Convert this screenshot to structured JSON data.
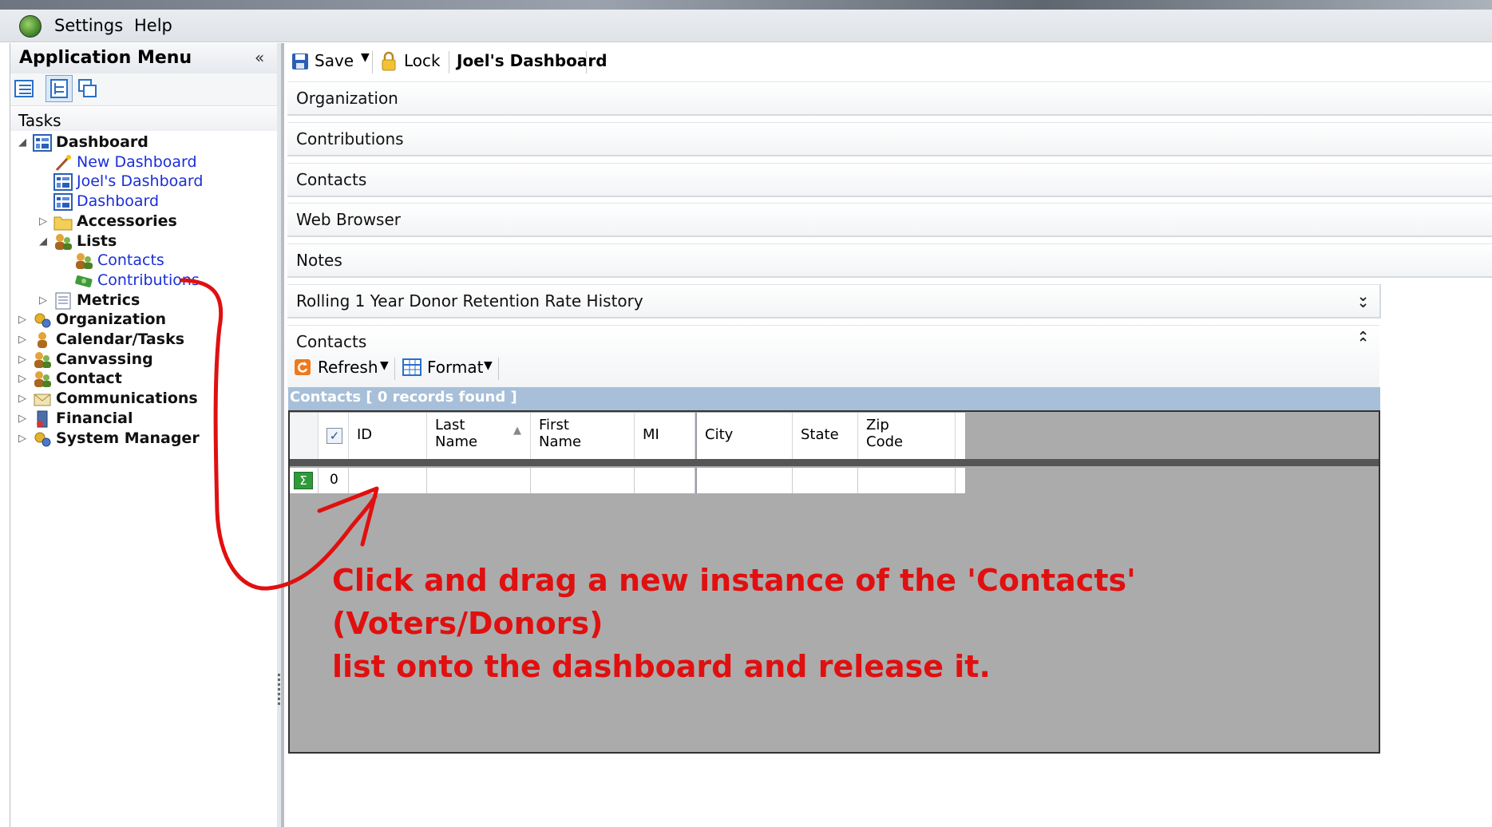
{
  "menubar": {
    "items": [
      "Settings",
      "Help"
    ]
  },
  "left_panel": {
    "title": "Application Menu",
    "collapse_glyph": "«",
    "tasks_label": "Tasks",
    "tree": [
      {
        "label": "Dashboard",
        "style": "bold",
        "icon": "dashboard-icon",
        "expander": "open"
      },
      {
        "label": "New Dashboard",
        "style": "link",
        "icon": "wand-icon",
        "expander": "none"
      },
      {
        "label": "Joel's Dashboard",
        "style": "link",
        "icon": "dashboard-icon",
        "expander": "none"
      },
      {
        "label": "Dashboard",
        "style": "link",
        "icon": "dashboard-icon",
        "expander": "none"
      },
      {
        "label": "Accessories",
        "style": "bold",
        "icon": "folder-icon",
        "expander": "closed"
      },
      {
        "label": "Lists",
        "style": "bold",
        "icon": "people-icon",
        "expander": "open"
      },
      {
        "label": "Contacts",
        "style": "link",
        "icon": "people-icon",
        "expander": "none"
      },
      {
        "label": "Contributions",
        "style": "link",
        "icon": "money-icon",
        "expander": "none"
      },
      {
        "label": "Metrics",
        "style": "bold",
        "icon": "report-icon",
        "expander": "closed"
      },
      {
        "label": "Organization",
        "style": "bold",
        "icon": "gears-icon",
        "expander": "closed"
      },
      {
        "label": "Calendar/Tasks",
        "style": "bold",
        "icon": "person-icon",
        "expander": "closed"
      },
      {
        "label": "Canvassing",
        "style": "bold",
        "icon": "people-icon",
        "expander": "closed"
      },
      {
        "label": "Contact",
        "style": "bold",
        "icon": "people-icon",
        "expander": "closed"
      },
      {
        "label": "Communications",
        "style": "bold",
        "icon": "envelope-icon",
        "expander": "closed"
      },
      {
        "label": "Financial",
        "style": "bold",
        "icon": "server-icon",
        "expander": "closed"
      },
      {
        "label": "System Manager",
        "style": "bold",
        "icon": "gears-icon",
        "expander": "closed"
      }
    ]
  },
  "toolbar": {
    "save_label": "Save",
    "lock_label": "Lock",
    "dashboard_tab": "Joel's Dashboard"
  },
  "sections": [
    "Organization",
    "Contributions",
    "Contacts",
    "Web Browser",
    "Notes",
    "Rolling 1 Year Donor Retention Rate History",
    "Contacts"
  ],
  "contacts_panel": {
    "refresh_label": "Refresh",
    "format_label": "Format",
    "caption": "Contacts [ 0 records found ]",
    "columns": [
      "ID",
      "Last\nName",
      "First\nName",
      "MI",
      "City",
      "State",
      "Zip\nCode"
    ],
    "row_value": "0"
  },
  "annotation": {
    "line1": "Click and drag a new instance of the 'Contacts' (Voters/Donors)",
    "line2": "list onto the dashboard and release it.",
    "color": "#e01010"
  }
}
